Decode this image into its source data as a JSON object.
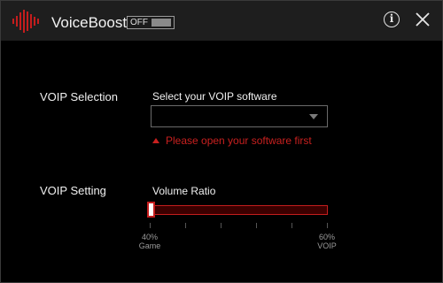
{
  "app": {
    "title": "VoiceBoost",
    "toggle_label": "OFF",
    "logo_icon": "waveform-icon",
    "info_icon": "info-icon",
    "close_icon": "close-icon"
  },
  "voip_selection": {
    "section_label": "VOIP Selection",
    "field_title": "Select your VOIP software",
    "dropdown_value": "",
    "warning": "Please open your software first"
  },
  "voip_setting": {
    "section_label": "VOIP Setting",
    "field_title": "Volume Ratio",
    "slider_value": 0,
    "left_percent": "40%",
    "left_name": "Game",
    "right_percent": "60%",
    "right_name": "VOIP"
  },
  "colors": {
    "accent": "#c41d1d",
    "background": "#000000",
    "titlebar": "#1e1e1e"
  }
}
